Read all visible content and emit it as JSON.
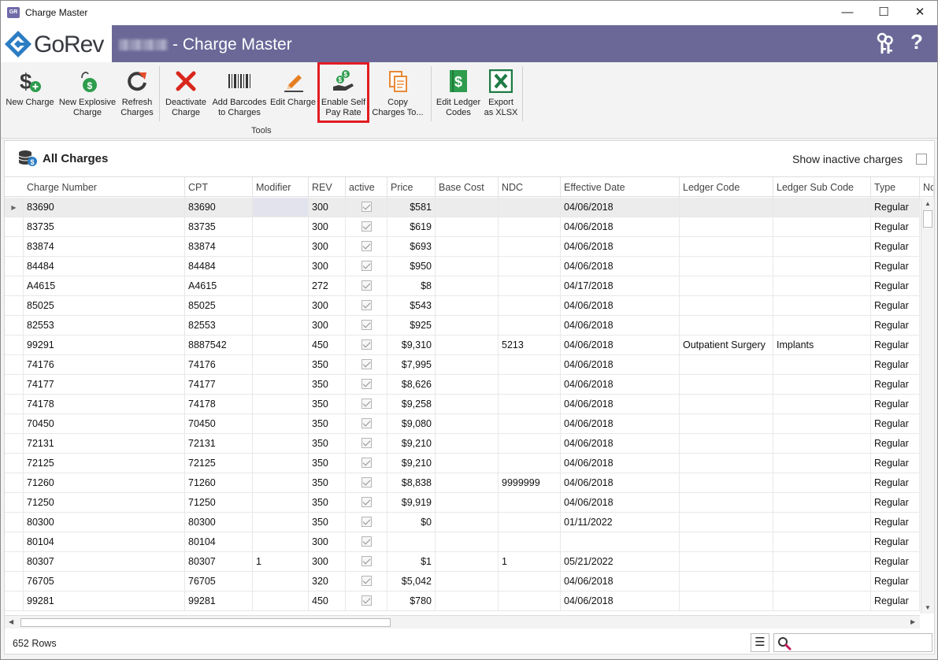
{
  "window": {
    "title": "Charge Master",
    "minimize": "—",
    "maximize": "☐",
    "close": "✕"
  },
  "header": {
    "logo_text": "GoRev",
    "title": "- Charge Master",
    "help": "?"
  },
  "ribbon": {
    "buttons": [
      {
        "label": "New Charge",
        "icon": "dollar-plus-icon"
      },
      {
        "label": "New Explosive Charge",
        "icon": "bomb-dollar-icon"
      },
      {
        "label": "Refresh Charges",
        "icon": "refresh-icon"
      },
      {
        "label": "Deactivate Charge",
        "icon": "red-x-icon"
      },
      {
        "label": "Add Barcodes to Charges",
        "icon": "barcode-icon"
      },
      {
        "label": "Edit Charge",
        "icon": "pencil-icon"
      },
      {
        "label": "Enable Self Pay Rate",
        "icon": "hand-money-icon"
      },
      {
        "label": "Copy Charges To...",
        "icon": "copy-documents-icon"
      },
      {
        "label": "Edit Ledger Codes",
        "icon": "ledger-dollar-icon"
      },
      {
        "label": "Export as XLSX",
        "icon": "excel-icon"
      }
    ],
    "group_label": "Tools",
    "highlight_color": "#e31b23"
  },
  "panel": {
    "title": "All Charges",
    "show_inactive_label": "Show inactive charges",
    "show_inactive_checked": false
  },
  "grid": {
    "columns": [
      "Charge Number",
      "CPT",
      "Modifier",
      "REV",
      "active",
      "Price",
      "Base Cost",
      "NDC",
      "Effective Date",
      "Ledger Code",
      "Ledger Sub Code",
      "Type",
      "No"
    ],
    "rows": [
      [
        "83690",
        "83690",
        "",
        "300",
        true,
        "$581",
        "",
        "",
        "04/06/2018",
        "",
        "",
        "Regular"
      ],
      [
        "83735",
        "83735",
        "",
        "300",
        true,
        "$619",
        "",
        "",
        "04/06/2018",
        "",
        "",
        "Regular"
      ],
      [
        "83874",
        "83874",
        "",
        "300",
        true,
        "$693",
        "",
        "",
        "04/06/2018",
        "",
        "",
        "Regular"
      ],
      [
        "84484",
        "84484",
        "",
        "300",
        true,
        "$950",
        "",
        "",
        "04/06/2018",
        "",
        "",
        "Regular"
      ],
      [
        "A4615",
        "A4615",
        "",
        "272",
        true,
        "$8",
        "",
        "",
        "04/17/2018",
        "",
        "",
        "Regular"
      ],
      [
        "85025",
        "85025",
        "",
        "300",
        true,
        "$543",
        "",
        "",
        "04/06/2018",
        "",
        "",
        "Regular"
      ],
      [
        "82553",
        "82553",
        "",
        "300",
        true,
        "$925",
        "",
        "",
        "04/06/2018",
        "",
        "",
        "Regular"
      ],
      [
        "99291",
        "8887542",
        "",
        "450",
        true,
        "$9,310",
        "",
        "5213",
        "04/06/2018",
        "Outpatient Surgery",
        "Implants",
        "Regular"
      ],
      [
        "74176",
        "74176",
        "",
        "350",
        true,
        "$7,995",
        "",
        "",
        "04/06/2018",
        "",
        "",
        "Regular"
      ],
      [
        "74177",
        "74177",
        "",
        "350",
        true,
        "$8,626",
        "",
        "",
        "04/06/2018",
        "",
        "",
        "Regular"
      ],
      [
        "74178",
        "74178",
        "",
        "350",
        true,
        "$9,258",
        "",
        "",
        "04/06/2018",
        "",
        "",
        "Regular"
      ],
      [
        "70450",
        "70450",
        "",
        "350",
        true,
        "$9,080",
        "",
        "",
        "04/06/2018",
        "",
        "",
        "Regular"
      ],
      [
        "72131",
        "72131",
        "",
        "350",
        true,
        "$9,210",
        "",
        "",
        "04/06/2018",
        "",
        "",
        "Regular"
      ],
      [
        "72125",
        "72125",
        "",
        "350",
        true,
        "$9,210",
        "",
        "",
        "04/06/2018",
        "",
        "",
        "Regular"
      ],
      [
        "71260",
        "71260",
        "",
        "350",
        true,
        "$8,838",
        "",
        "9999999",
        "04/06/2018",
        "",
        "",
        "Regular"
      ],
      [
        "71250",
        "71250",
        "",
        "350",
        true,
        "$9,919",
        "",
        "",
        "04/06/2018",
        "",
        "",
        "Regular"
      ],
      [
        "80300",
        "80300",
        "",
        "350",
        true,
        "$0",
        "",
        "",
        "01/11/2022",
        "",
        "",
        "Regular"
      ],
      [
        "80104",
        "80104",
        "",
        "300",
        true,
        "",
        "",
        "",
        "",
        "",
        "",
        "Regular"
      ],
      [
        "80307",
        "80307",
        "1",
        "300",
        true,
        "$1",
        "",
        "1",
        "05/21/2022",
        "",
        "",
        "Regular"
      ],
      [
        "76705",
        "76705",
        "",
        "320",
        true,
        "$5,042",
        "",
        "",
        "04/06/2018",
        "",
        "",
        "Regular"
      ],
      [
        "99281",
        "99281",
        "",
        "450",
        true,
        "$780",
        "",
        "",
        "04/06/2018",
        "",
        "",
        "Regular"
      ]
    ]
  },
  "footer": {
    "row_count": "652 Rows",
    "search_placeholder": ""
  }
}
